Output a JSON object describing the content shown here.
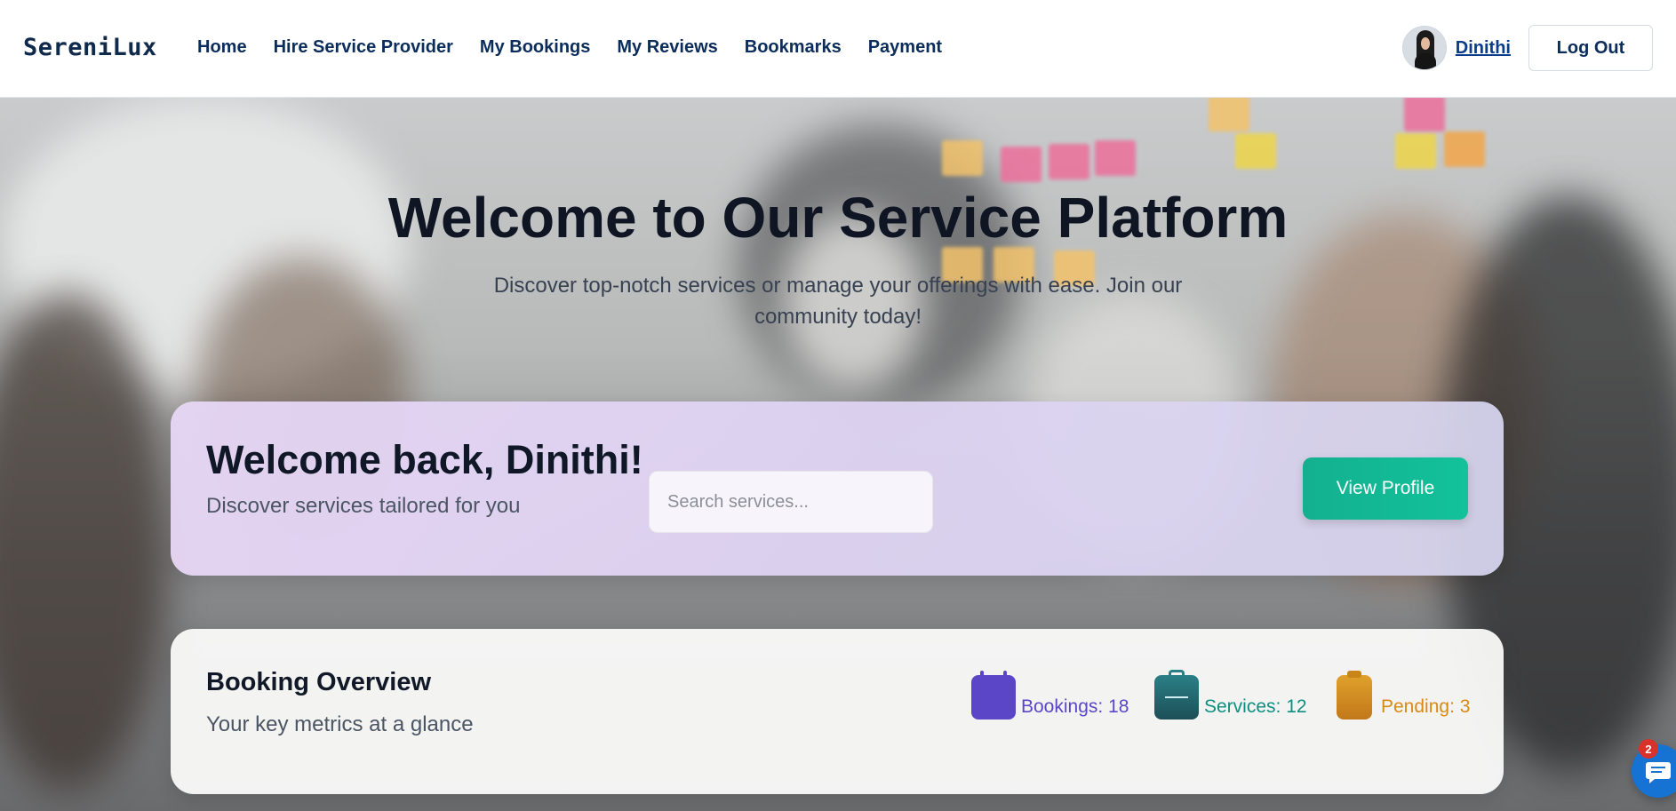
{
  "nav": {
    "brand": "SereniLux",
    "items": [
      {
        "label": "Home"
      },
      {
        "label": "Hire Service Provider"
      },
      {
        "label": "My Bookings"
      },
      {
        "label": "My Reviews"
      },
      {
        "label": "Bookmarks"
      },
      {
        "label": "Payment"
      }
    ],
    "user_name": "Dinithi",
    "logout_label": "Log Out"
  },
  "hero": {
    "title": "Welcome to Our Service Platform",
    "subtitle": "Discover top-notch services or manage your offerings with ease. Join our community today!"
  },
  "welcome_card": {
    "title": "Welcome back, Dinithi!",
    "subtitle": "Discover services tailored for you",
    "search_placeholder": "Search services...",
    "view_profile_label": "View Profile"
  },
  "overview": {
    "title": "Booking Overview",
    "subtitle": "Your key metrics at a glance",
    "metrics": [
      {
        "label": "Bookings: 18",
        "icon": "calendar-icon",
        "color": "#5b46c8"
      },
      {
        "label": "Services: 12",
        "icon": "briefcase-icon",
        "color": "#0d8f80"
      },
      {
        "label": "Pending: 3",
        "icon": "clipboard-icon",
        "color": "#d98a12"
      }
    ]
  },
  "chat": {
    "badge": "2",
    "icon": "chat-icon"
  }
}
